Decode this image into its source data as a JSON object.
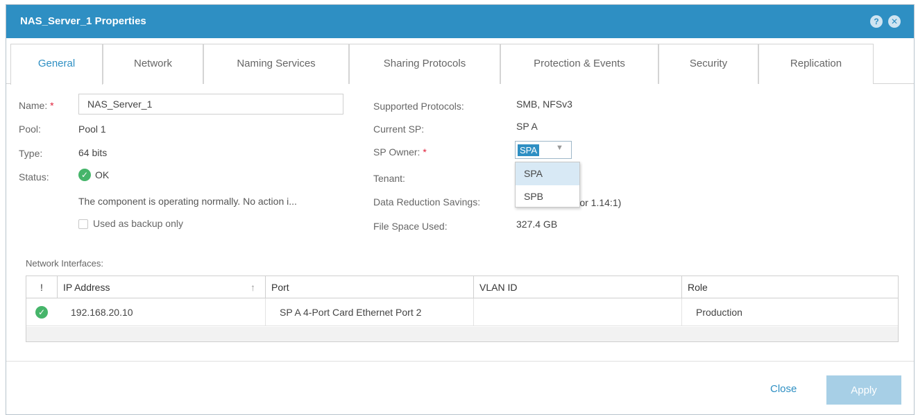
{
  "dialog": {
    "title": "NAS_Server_1 Properties",
    "help_icon": "question-icon",
    "close_icon": "close-icon"
  },
  "tabs": [
    {
      "label": "General",
      "active": true
    },
    {
      "label": "Network"
    },
    {
      "label": "Naming Services"
    },
    {
      "label": "Sharing Protocols"
    },
    {
      "label": "Protection & Events"
    },
    {
      "label": "Security"
    },
    {
      "label": "Replication"
    }
  ],
  "general": {
    "name_label": "Name:",
    "required_mark": "*",
    "name_value": "NAS_Server_1",
    "pool_label": "Pool:",
    "pool_value": "Pool 1",
    "type_label": "Type:",
    "type_value": "64 bits",
    "status_label": "Status:",
    "status_value": "OK",
    "status_message": "The component is operating normally. No action i...",
    "backup_label": "Used as backup only",
    "supported_protocols_label": "Supported Protocols:",
    "supported_protocols_value": "SMB, NFSv3",
    "current_sp_label": "Current SP:",
    "current_sp_value": "SP A",
    "sp_owner_label": "SP Owner:",
    "sp_owner_value": "SPA",
    "tenant_label": "Tenant:",
    "data_reduction_label": "Data Reduction Savings:",
    "data_reduction_value": "% or 1.14:1)",
    "file_space_label": "File Space Used:",
    "file_space_value": "327.4 GB",
    "sp_options": [
      "SPA",
      "SPB"
    ]
  },
  "network_interfaces": {
    "label": "Network Interfaces:",
    "columns": [
      "!",
      "IP Address",
      "Port",
      "VLAN ID",
      "Role"
    ],
    "rows": [
      {
        "ip": "192.168.20.10",
        "port": "SP A 4-Port Card Ethernet Port 2",
        "vlan": "",
        "role": "Production"
      }
    ]
  },
  "footer": {
    "close_label": "Close",
    "apply_label": "Apply"
  },
  "colors": {
    "accent": "#2e8fc3",
    "ok": "#46b56a",
    "required": "#e0203a"
  }
}
